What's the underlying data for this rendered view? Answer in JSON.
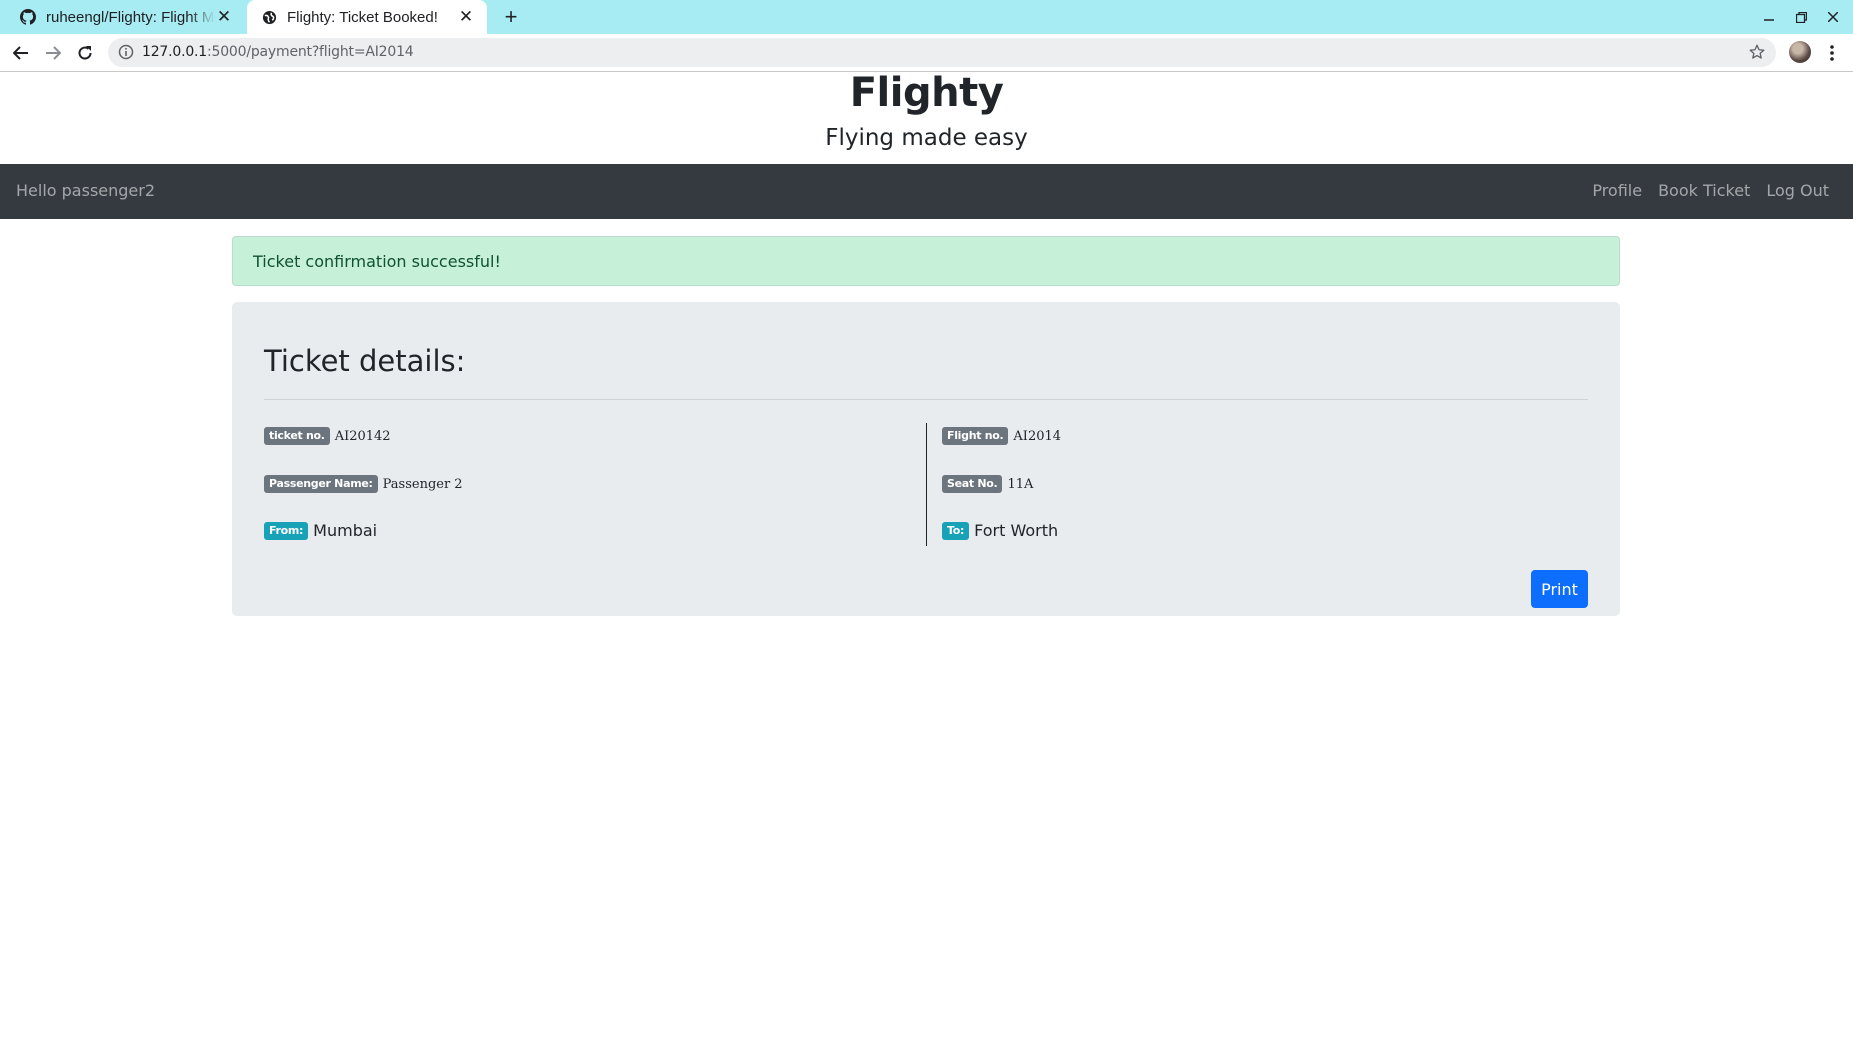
{
  "browser": {
    "tabs": [
      {
        "title": "ruheengl/Flighty: Flight Management",
        "favicon": "github-icon",
        "active": false
      },
      {
        "title": "Flighty: Ticket Booked!",
        "favicon": "globe-icon",
        "active": true
      }
    ],
    "url_host": "127.0.0.1",
    "url_rest": ":5000/payment?flight=AI2014"
  },
  "site": {
    "brand": "Flighty",
    "tagline": "Flying made easy"
  },
  "navbar": {
    "greeting": "Hello passenger2",
    "links": [
      "Profile",
      "Book Ticket",
      "Log Out"
    ]
  },
  "alert": {
    "message": "Ticket confirmation successful!",
    "color": "#c7f0d8"
  },
  "ticket": {
    "heading": "Ticket details:",
    "left": [
      {
        "label": "ticket no.",
        "value": "AI20142"
      },
      {
        "label": "Passenger Name:",
        "value": "Passenger 2"
      },
      {
        "label": "From:",
        "value": "Mumbai"
      }
    ],
    "right": [
      {
        "label": "Flight no.",
        "value": "AI2014"
      },
      {
        "label": "Seat No.",
        "value": "11A"
      },
      {
        "label": "To:",
        "value": "Fort Worth"
      }
    ],
    "print_label": "Print",
    "colors": {
      "badge_default": "#6c757d",
      "badge_info": "#17a2b8",
      "button": "#0d6efd",
      "navbar": "#343a40"
    }
  }
}
